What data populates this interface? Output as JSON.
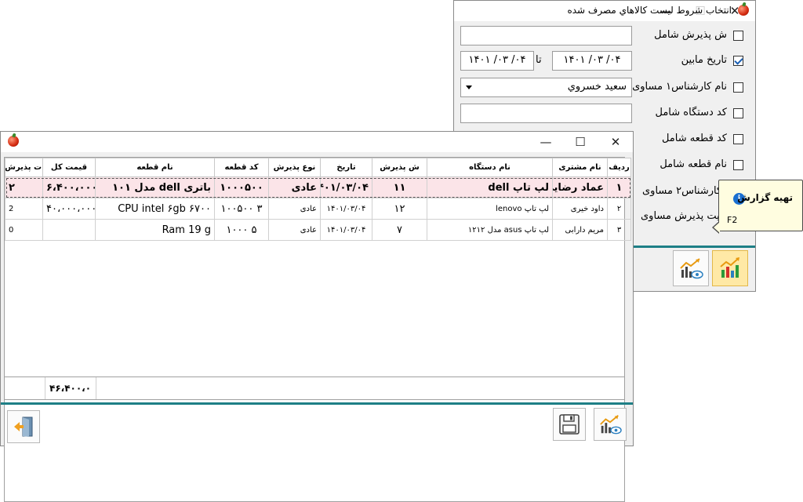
{
  "dialog": {
    "title": "انتخاب شروط ليست کالاهاي مصرف شده",
    "filters": [
      {
        "label": "ش پذیرش شامل",
        "checked": false,
        "value": ""
      },
      {
        "label": "تاریخ مابین",
        "checked": true,
        "from": "۱۴۰۱ /۰۳ /۰۴",
        "to": "۱۴۰۱ /۰۳ /۰۴",
        "between": "تا"
      },
      {
        "label": "نام کارشناس۱ مساوی",
        "checked": false,
        "value": "سعيد خسروي"
      },
      {
        "label": "کد دستگاه شامل",
        "checked": false,
        "value": ""
      },
      {
        "label": "کد قطعه شامل",
        "checked": false
      },
      {
        "label": "نام قطعه شامل",
        "checked": false
      },
      {
        "label": "نام کارشناس۲ مساوی",
        "visible": "کارشناس۲ مساوی"
      },
      {
        "label": "وضعیت پذیرش مساوی",
        "visible": "عیت پذیرش مساوی"
      }
    ]
  },
  "tooltip": {
    "title": "تهیه گزارش",
    "shortcut": "F2"
  },
  "report": {
    "columns": [
      "ردیف",
      "نام مشتری",
      "نام دستگاه",
      "ش پذیرش",
      "تاریخ",
      "نوع پذیرش",
      "کد قطعه",
      "نام قطعه",
      "قیمت کل",
      "ت پذیرش"
    ],
    "rows": [
      {
        "row": "۱",
        "customer": "عماد رضایی",
        "device": "لپ تاپ dell",
        "reception": "۱۱",
        "date": "۱۴۰۱/۰۳/۰۴",
        "type": "عادی",
        "code": "۱۰۰۰۵۰۰",
        "part": "باتری dell مدل ۱۰۱",
        "price": "۶،۴۰۰،۰۰۰",
        "count": "۲"
      },
      {
        "row": "۲",
        "customer": "داود خیری",
        "device": "لپ تاپ lenovo",
        "reception": "۱۲",
        "date": "۱۴۰۱/۰۳/۰۴",
        "type": "عادی",
        "code": "۳ ۱۰۰۵۰۰",
        "part": "CPU intel ۶gb ۶۷۰۰",
        "price": "۴۰،۰۰۰،۰۰۰",
        "count": "2"
      },
      {
        "row": "۳",
        "customer": "مریم دارابی",
        "device": "لپ تاپ asus مدل ۱۲۱۲",
        "reception": "۷",
        "date": "۱۴۰۱/۰۳/۰۴",
        "type": "عادی",
        "code": "۵ ۱۰۰۰",
        "part": "Ram 19 g",
        "price": "",
        "count": "0"
      }
    ],
    "total": "۴۶،۴۰۰،۰"
  },
  "icons": {
    "report_preview": "chart-preview-icon",
    "report": "chart-icon",
    "save": "floppy-disk-icon",
    "exit": "exit-door-icon"
  }
}
